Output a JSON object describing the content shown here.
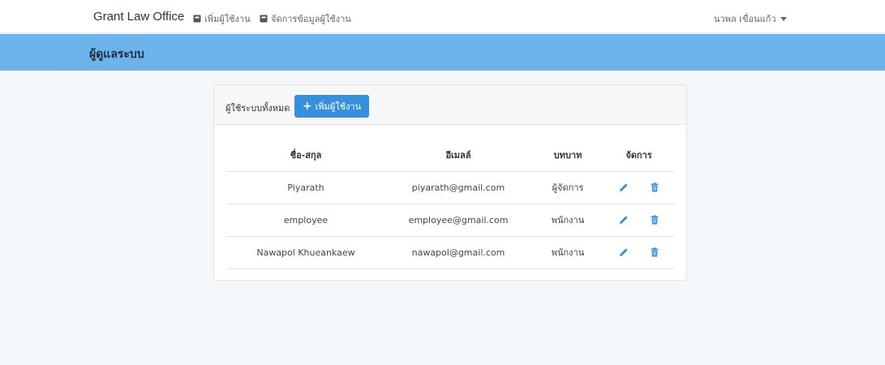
{
  "nav": {
    "brand": "Grant Law Office",
    "links": [
      {
        "label": "เพิ่มผู้ใช้งาน",
        "icon": "square-icon"
      },
      {
        "label": "จัดการข้อมูลผู้ใช้งาน",
        "icon": "square-icon"
      }
    ],
    "user": "นวพล เขื่อนแก้ว"
  },
  "banner": {
    "title": "ผู้ดูแลระบบ"
  },
  "card": {
    "header_label": "ผู้ใช้ระบบทั้งหมด",
    "add_button": "เพิ่มผู้ใช้งาน"
  },
  "table": {
    "headers": [
      "ชื่อ-สกุล",
      "อีเมลล์",
      "บทบาท",
      "จัดการ"
    ],
    "rows": [
      {
        "name": "Piyarath",
        "email": "piyarath@gmail.com",
        "role": "ผู้จัดการ"
      },
      {
        "name": "employee",
        "email": "employee@gmail.com",
        "role": "พนักงาน"
      },
      {
        "name": "Nawapol Khueankaew",
        "email": "nawapol@gmail.com",
        "role": "พนักงาน"
      }
    ]
  },
  "colors": {
    "banner": "#6cb2eb",
    "primary_button": "#3490dc",
    "icon": "#3490dc"
  }
}
